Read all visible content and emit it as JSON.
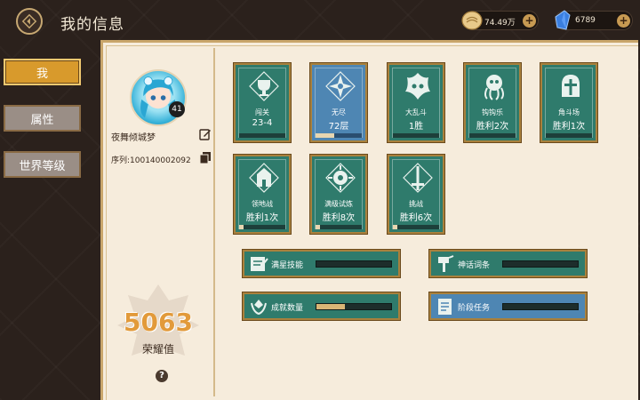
{
  "header": {
    "title": "我的信息"
  },
  "currency": {
    "gold": {
      "value": "74.49万",
      "icon": "coin-icon",
      "plus": "+"
    },
    "gems": {
      "value": "6789",
      "icon": "crystal-icon",
      "plus": "+"
    }
  },
  "nav": {
    "items": [
      {
        "label": "我",
        "active": true
      },
      {
        "label": "属性",
        "active": false
      },
      {
        "label": "世界等级",
        "active": false
      }
    ]
  },
  "profile": {
    "level": "41",
    "name": "夜舞倾城梦",
    "id_label": "序列:100140002092",
    "honor_value": "5063",
    "honor_label": "荣耀值",
    "help": "?"
  },
  "cards": [
    {
      "name": "闯关",
      "value": "23-4",
      "color": "#2f7b6c",
      "progress": 0
    },
    {
      "name": "无尽",
      "value": "72层",
      "color": "#4e86b3",
      "progress": 0.4
    },
    {
      "name": "大乱斗",
      "value": "1胜",
      "color": "#2f7b6c",
      "progress": 0
    },
    {
      "name": "钩钩乐",
      "value": "胜利2次",
      "color": "#2f7b6c",
      "progress": 0
    },
    {
      "name": "角斗场",
      "value": "胜利1次",
      "color": "#2f7b6c",
      "progress": 0
    },
    {
      "name": "领地战",
      "value": "胜利1次",
      "color": "#2f7b6c",
      "progress": 0.1
    },
    {
      "name": "满级试炼",
      "value": "胜利8次",
      "color": "#2f7b6c",
      "progress": 0.1
    },
    {
      "name": "挑战",
      "value": "胜利6次",
      "color": "#2f7b6c",
      "progress": 0.1
    }
  ],
  "progress": [
    {
      "label": "满星技能",
      "fill": 0.0,
      "color": "#2f7b6c"
    },
    {
      "label": "神话词条",
      "fill": 0.0,
      "color": "#2f7b6c"
    },
    {
      "label": "成就数量",
      "fill": 0.38,
      "color": "#2f7b6c"
    },
    {
      "label": "阶段任务",
      "fill": 0.0,
      "color": "#4e86b3"
    }
  ]
}
